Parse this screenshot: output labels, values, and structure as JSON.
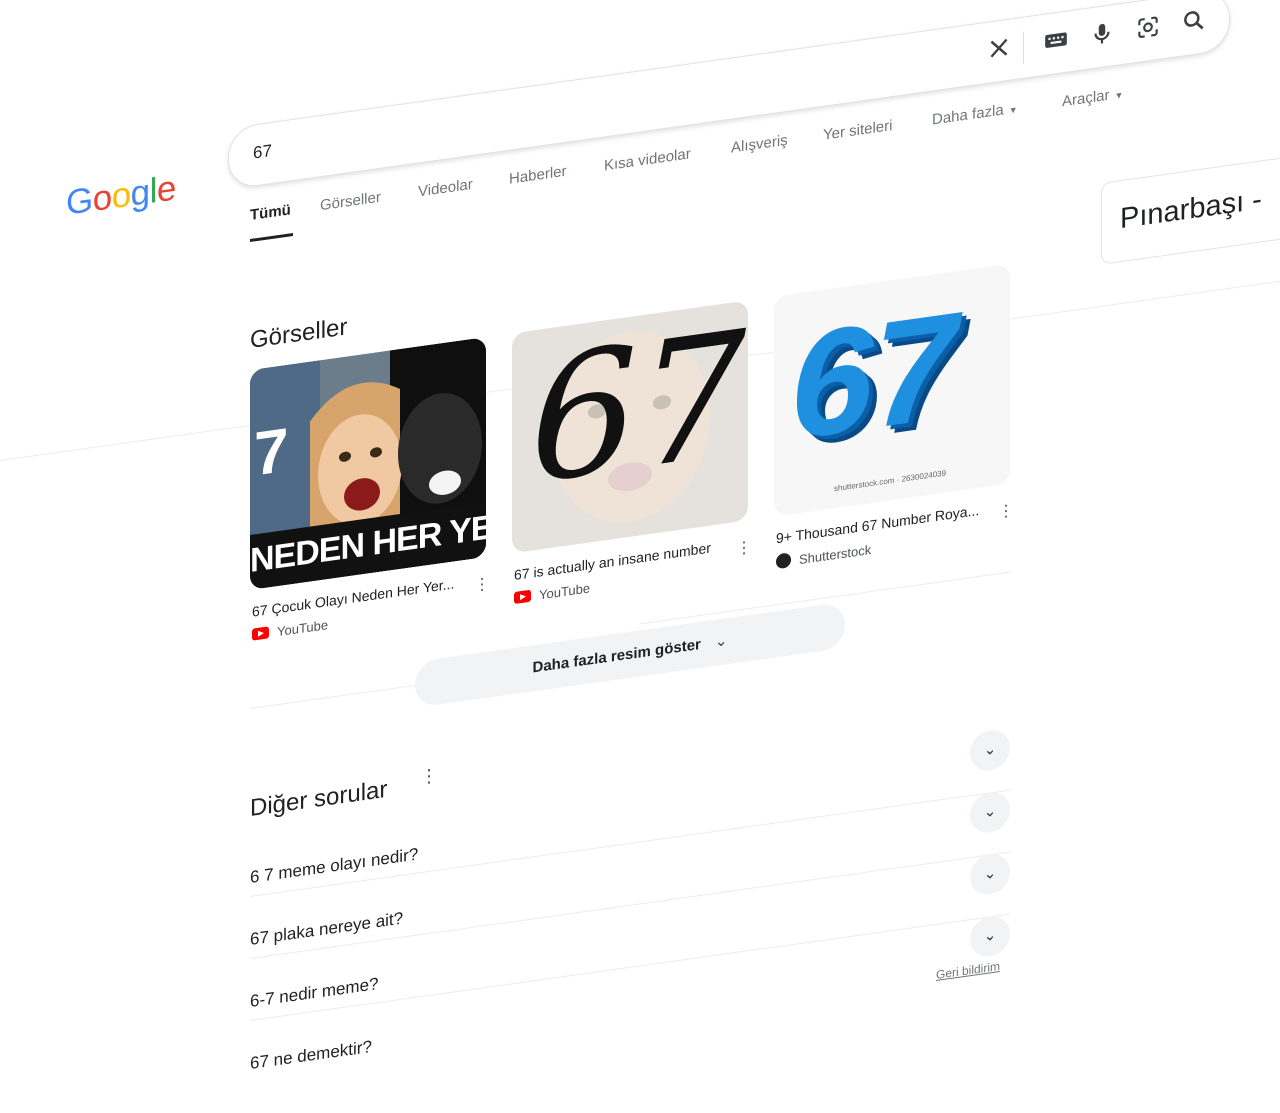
{
  "logo": {
    "letters": [
      "G",
      "o",
      "o",
      "g",
      "l",
      "e"
    ],
    "colors": [
      "#4285F4",
      "#EA4335",
      "#FBBC05",
      "#4285F4",
      "#34A853",
      "#EA4335"
    ]
  },
  "search": {
    "query": "67"
  },
  "tabs": [
    {
      "label": "Tümü",
      "active": true
    },
    {
      "label": "Görseller"
    },
    {
      "label": "Videolar"
    },
    {
      "label": "Haberler"
    },
    {
      "label": "Kısa videolar"
    },
    {
      "label": "Alışveriş"
    },
    {
      "label": "Yer siteleri"
    },
    {
      "label": "Daha fazla"
    },
    {
      "label": "Araçlar"
    }
  ],
  "knowledge_panel": {
    "title": "Pınarbaşı -"
  },
  "images_section": {
    "title": "Görseller",
    "items": [
      {
        "caption": "67 Çocuk Olayı Neden Her Yer...",
        "source": "YouTube",
        "overlay": "NEDEN HER YER",
        "overlay_digit": "7"
      },
      {
        "caption": "67 is actually an insane number",
        "source": "YouTube",
        "overlay": "67"
      },
      {
        "caption": "9+ Thousand 67 Number Roya...",
        "source": "Shutterstock",
        "overlay": "67",
        "watermark": "shutterstock.com · 2630024039"
      }
    ],
    "more_button": "Daha fazla resim göster"
  },
  "paa": {
    "title": "Diğer sorular",
    "questions": [
      "6 7 meme olayı nedir?",
      "67 plaka nereye ait?",
      "6-7 nedir meme?",
      "67 ne demektir?"
    ],
    "feedback": "Geri bildirim"
  }
}
